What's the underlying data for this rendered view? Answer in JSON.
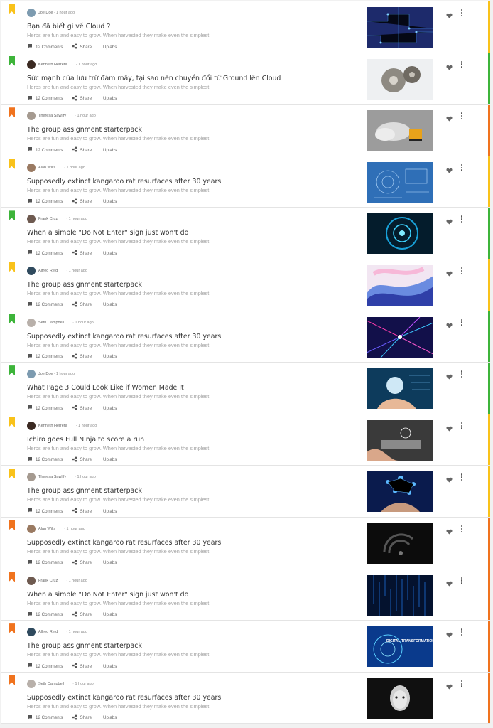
{
  "labels": {
    "comments": "12 Comments",
    "share": "Share",
    "extra": "Uplabs"
  },
  "excerpt": "Herbs are fun and easy to grow. When harvested they make even the simplest.",
  "colors": {
    "yellow": "#f9c21a",
    "green": "#3db43a",
    "orange": "#f0731e"
  },
  "posts": [
    {
      "author": "Joe Doe",
      "time": "· 1 hour ago",
      "inline_time": true,
      "title": "Bạn đã biết gì về Cloud ?",
      "tag": "yellow",
      "avatar": "#7d9bb0",
      "thumb": "circuit-blue"
    },
    {
      "author": "Kenneth Herrera",
      "time": "· 1 hour ago",
      "inline_time": false,
      "title": "Sức mạnh của lưu trữ đám mây, tại sao nên chuyển đổi từ Ground lên Cloud",
      "tag": "green",
      "avatar": "#3b2a22",
      "thumb": "gears"
    },
    {
      "author": "Theresa Sawlify",
      "time": "· 1 hour ago",
      "inline_time": false,
      "title": "The group assignment starterpack",
      "tag": "orange",
      "avatar": "#a59a90",
      "thumb": "cloud-server"
    },
    {
      "author": "Alan Wills",
      "time": "· 1 hour ago",
      "inline_time": false,
      "title": "Supposedly extinct kangaroo rat resurfaces after 30 years",
      "tag": "yellow",
      "avatar": "#9a7a62",
      "thumb": "blueprint"
    },
    {
      "author": "Frank Cruz",
      "time": "· 1 hour ago",
      "inline_time": false,
      "title": "When a simple \"Do Not Enter\" sign just won't do",
      "tag": "green",
      "avatar": "#6e5a50",
      "thumb": "tech-tunnel"
    },
    {
      "author": "Alfred Reid",
      "time": "· 1 hour ago",
      "inline_time": false,
      "title": "The group assignment starterpack",
      "tag": "yellow",
      "avatar": "#2f4a5e",
      "thumb": "pastel-wave"
    },
    {
      "author": "Seth Campbell",
      "time": "· 1 hour ago",
      "inline_time": false,
      "title": "Supposedly extinct kangaroo rat resurfaces after 30 years",
      "tag": "green",
      "avatar": "#b8b0aa",
      "thumb": "neon-lines"
    },
    {
      "author": "Joe Doe",
      "time": "· 1 hour ago",
      "inline_time": true,
      "title": "What Page 3 Could Look Like if Women Made It",
      "tag": "green",
      "avatar": "#7d9bb0",
      "thumb": "globe-hand"
    },
    {
      "author": "Kenneth Herrera",
      "time": "· 1 hour ago",
      "inline_time": false,
      "title": "Ichiro goes Full Ninja to score a run",
      "tag": "yellow",
      "avatar": "#3b2a22",
      "thumb": "tablet-hands"
    },
    {
      "author": "Theresa Sawlify",
      "time": "· 1 hour ago",
      "inline_time": false,
      "title": "The group assignment starterpack",
      "tag": "yellow",
      "avatar": "#a59a90",
      "thumb": "network-hand"
    },
    {
      "author": "Alan Wills",
      "time": "· 1 hour ago",
      "inline_time": false,
      "title": "Supposedly extinct kangaroo rat resurfaces after 30 years",
      "tag": "orange",
      "avatar": "#9a7a62",
      "thumb": "wifi-dark"
    },
    {
      "author": "Frank Cruz",
      "time": "· 1 hour ago",
      "inline_time": false,
      "title": "When a simple \"Do Not Enter\" sign just won't do",
      "tag": "orange",
      "avatar": "#6e5a50",
      "thumb": "data-rain"
    },
    {
      "author": "Alfred Reid",
      "time": "· 1 hour ago",
      "inline_time": false,
      "title": "The group assignment starterpack",
      "tag": "orange",
      "avatar": "#2f4a5e",
      "thumb": "digital-transformation",
      "thumb_text": "DIGITAL TRANSFORMATION"
    },
    {
      "author": "Seth Campbell",
      "time": "· 1 hour ago",
      "inline_time": false,
      "title": "Supposedly extinct kangaroo rat resurfaces after 30 years",
      "tag": "orange",
      "avatar": "#b8b0aa",
      "thumb": "robot-face"
    }
  ]
}
